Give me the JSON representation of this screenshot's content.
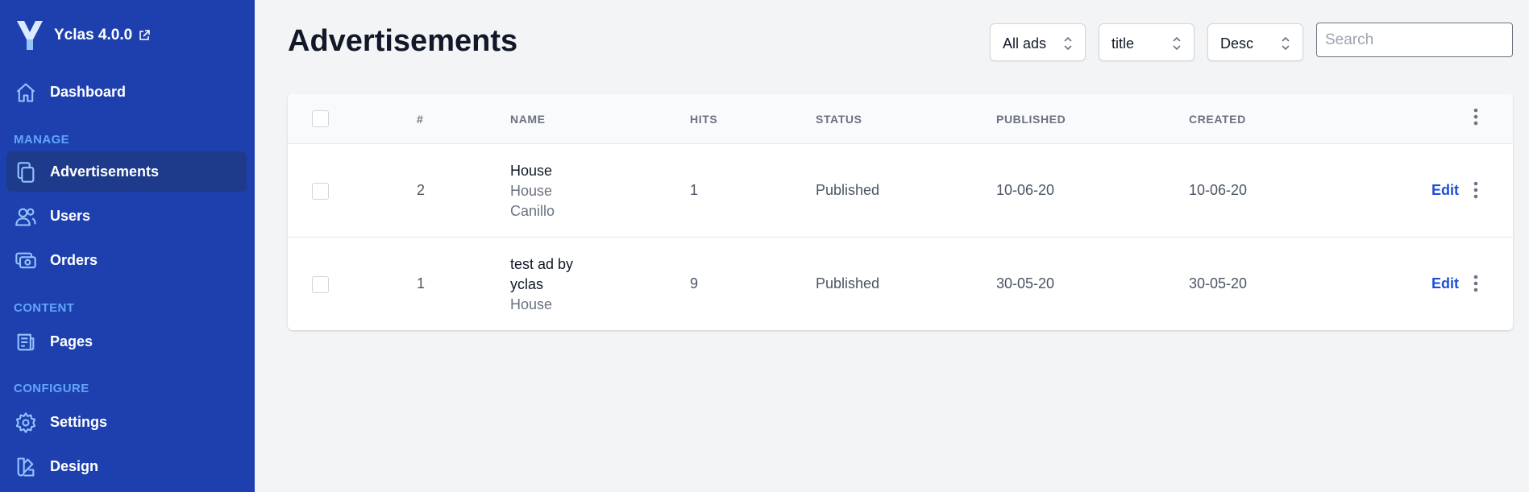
{
  "brand": {
    "name": "Yclas 4.0.0",
    "logo_icon": "yclas-logo-icon",
    "external_icon": "external-link-icon"
  },
  "sidebar": {
    "dashboard": {
      "label": "Dashboard",
      "icon": "home-icon"
    },
    "sections": {
      "manage": "MANAGE",
      "content": "CONTENT",
      "configure": "CONFIGURE"
    },
    "items": [
      {
        "label": "Advertisements",
        "icon": "copy-icon",
        "active": true
      },
      {
        "label": "Users",
        "icon": "users-icon"
      },
      {
        "label": "Orders",
        "icon": "cash-icon"
      },
      {
        "label": "Pages",
        "icon": "newspaper-icon"
      },
      {
        "label": "Settings",
        "icon": "cog-icon"
      },
      {
        "label": "Design",
        "icon": "color-swatch-icon"
      }
    ]
  },
  "page": {
    "title": "Advertisements"
  },
  "filters": {
    "ads_filter": "All ads",
    "sort_field": "title",
    "sort_order": "Desc",
    "search_placeholder": "Search"
  },
  "table": {
    "headers": {
      "id": "#",
      "name": "NAME",
      "hits": "HITS",
      "status": "STATUS",
      "published": "PUBLISHED",
      "created": "CREATED"
    },
    "rows": [
      {
        "id": "2",
        "name": "House",
        "sub1": "House",
        "sub2": "Canillo",
        "hits": "1",
        "status": "Published",
        "published": "10-06-20",
        "created": "10-06-20",
        "action": "Edit"
      },
      {
        "id": "1",
        "name1": "test ad by",
        "name2": "yclas",
        "sub1": "House",
        "hits": "9",
        "status": "Published",
        "published": "30-05-20",
        "created": "30-05-20",
        "action": "Edit"
      }
    ]
  },
  "colors": {
    "sidebar": "#1e40af",
    "active_item": "#1e3a8a",
    "section_label": "#60a5fa",
    "link": "#1d4ed8"
  }
}
